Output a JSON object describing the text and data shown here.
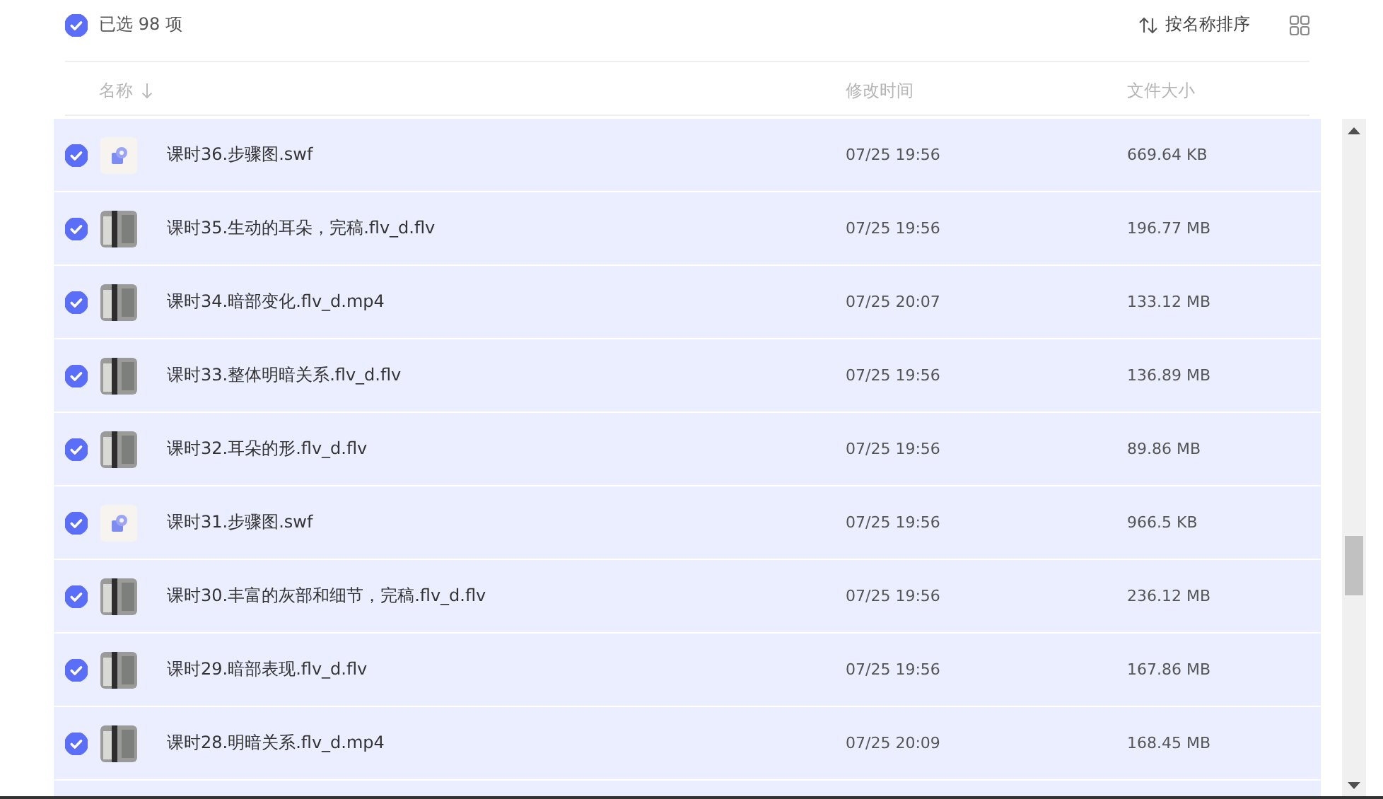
{
  "selection": {
    "checked": true,
    "label": "已选 98 项"
  },
  "sort": {
    "label": "按名称排序"
  },
  "columns": [
    {
      "label": "名称",
      "sorted": true
    },
    {
      "label": "修改时间",
      "sorted": false
    },
    {
      "label": "文件大小",
      "sorted": false
    }
  ],
  "rows": [
    {
      "kind": "swf",
      "selected": true,
      "name": "课时36.步骤图.swf",
      "modified": "07/25 19:56",
      "size": "669.64 KB"
    },
    {
      "kind": "video",
      "selected": true,
      "name": "课时35.生动的耳朵，完稿.flv_d.flv",
      "modified": "07/25 19:56",
      "size": "196.77 MB"
    },
    {
      "kind": "video",
      "selected": true,
      "name": "课时34.暗部变化.flv_d.mp4",
      "modified": "07/25 20:07",
      "size": "133.12 MB"
    },
    {
      "kind": "video",
      "selected": true,
      "name": "课时33.整体明暗关系.flv_d.flv",
      "modified": "07/25 19:56",
      "size": "136.89 MB"
    },
    {
      "kind": "video",
      "selected": true,
      "name": "课时32.耳朵的形.flv_d.flv",
      "modified": "07/25 19:56",
      "size": "89.86 MB"
    },
    {
      "kind": "swf",
      "selected": true,
      "name": "课时31.步骤图.swf",
      "modified": "07/25 19:56",
      "size": "966.5 KB"
    },
    {
      "kind": "video",
      "selected": true,
      "name": "课时30.丰富的灰部和细节，完稿.flv_d.flv",
      "modified": "07/25 19:56",
      "size": "236.12 MB"
    },
    {
      "kind": "video",
      "selected": true,
      "name": "课时29.暗部表现.flv_d.flv",
      "modified": "07/25 19:56",
      "size": "167.86 MB"
    },
    {
      "kind": "video",
      "selected": true,
      "name": "课时28.明暗关系.flv_d.mp4",
      "modified": "07/25 20:09",
      "size": "168.45 MB"
    }
  ]
}
